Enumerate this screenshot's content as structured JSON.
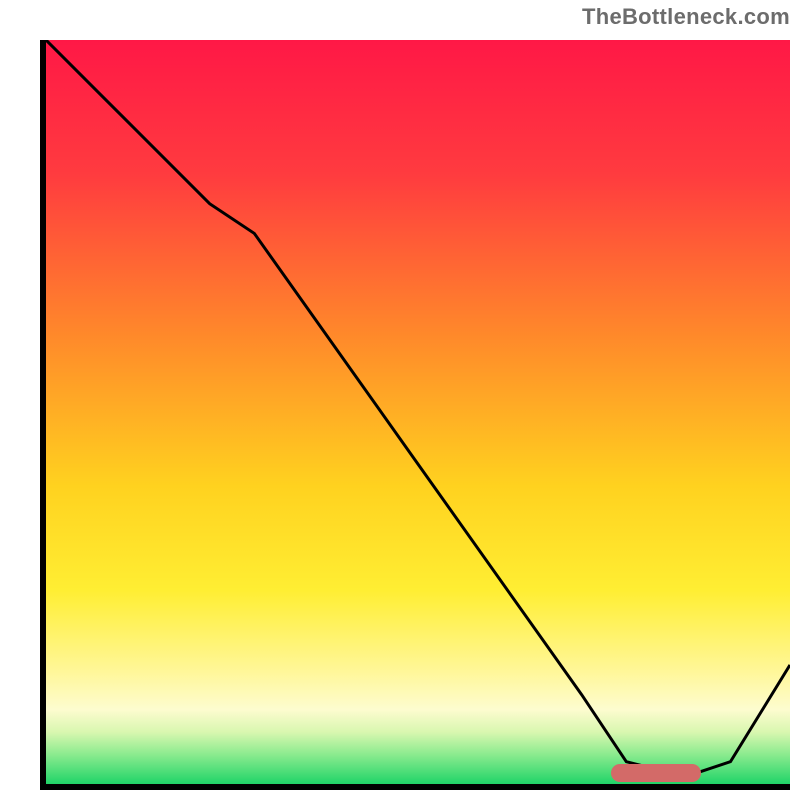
{
  "attribution": "TheBottleneck.com",
  "chart_data": {
    "type": "line",
    "title": "",
    "xlabel": "",
    "ylabel": "",
    "xlim": [
      0,
      100
    ],
    "ylim": [
      0,
      100
    ],
    "gradient_stops": [
      {
        "offset": 0,
        "color": "#ff1846"
      },
      {
        "offset": 18,
        "color": "#ff3b3f"
      },
      {
        "offset": 40,
        "color": "#ff8a2a"
      },
      {
        "offset": 60,
        "color": "#ffd21f"
      },
      {
        "offset": 74,
        "color": "#ffee33"
      },
      {
        "offset": 85,
        "color": "#fff79a"
      },
      {
        "offset": 90,
        "color": "#fdfccf"
      },
      {
        "offset": 93,
        "color": "#d9f7b0"
      },
      {
        "offset": 96,
        "color": "#8ceb8f"
      },
      {
        "offset": 100,
        "color": "#20d468"
      }
    ],
    "series": [
      {
        "name": "bottleneck-curve",
        "x": [
          0,
          8,
          22,
          28,
          50,
          72,
          78,
          86,
          92,
          100
        ],
        "y": [
          100,
          92,
          78,
          74,
          43,
          12,
          3,
          1,
          3,
          16
        ]
      }
    ],
    "marker": {
      "name": "optimal-range",
      "x_start": 76,
      "x_end": 88,
      "y": 1.5,
      "color": "#d36a68"
    }
  }
}
